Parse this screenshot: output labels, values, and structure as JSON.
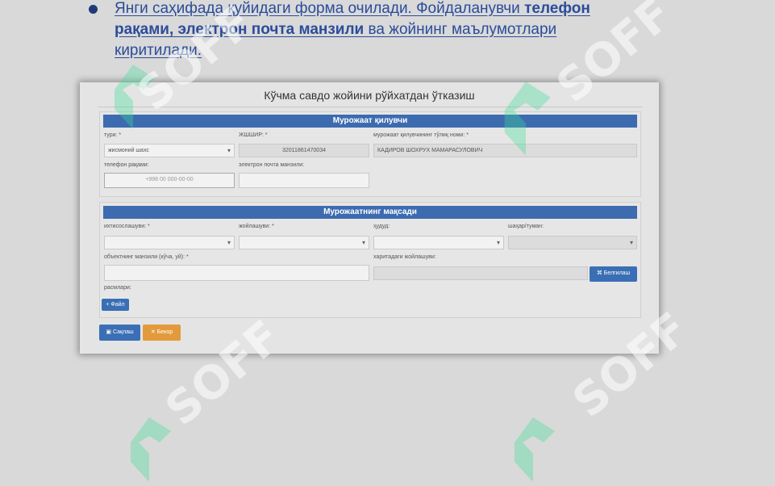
{
  "slide": {
    "bullet_part1": "Янги саҳифада қуйидаги форма очилади. Фойдаланувчи ",
    "bullet_bold1": "телефон рақами, электрон почта манзили",
    "bullet_part2": " ва жойнинг маълумотлари киритилади."
  },
  "form": {
    "title": "Кўчма савдо жойини рўйхатдан ўтказиш",
    "applicant": {
      "header": "Мурожаат қилувчи",
      "type_label": "тури: *",
      "type_value": "жисмоний шахс",
      "pinfl_label": "ЖШШИР: *",
      "pinfl_value": "32011861470034",
      "fullname_label": "мурожаат қилувчининг тўлиқ номи: *",
      "fullname_value": "КАДИРОВ ШОХРУХ МАМАРАСУЛОВИЧ",
      "phone_label": "телефон рақами:",
      "phone_placeholder": "+998 00 000-00-00",
      "email_label": "электрон почта манзили:"
    },
    "purpose": {
      "header": "Мурожаатнинг мақсади",
      "specialization_label": "ихтисослашуви: *",
      "placement_label": "жойлашуви: *",
      "region_label": "ҳудуд:",
      "district_label": "шаҳар/туман:",
      "address_label": "объектнинг манзили (кўча, уй): *",
      "map_label": "харитадаги жойлашуви:",
      "map_button": "Белгилаш",
      "pictures_label": "расмлари:",
      "file_button": "+ Файл"
    },
    "actions": {
      "save": "Сақлаш",
      "cancel": "Бекор"
    }
  },
  "watermark": {
    "text": "SOFF"
  },
  "colors": {
    "accent": "#3c6bb0",
    "cancel": "#e39a3c",
    "link_text": "#2b4c9a",
    "watermark_green": "#3ddc97"
  }
}
